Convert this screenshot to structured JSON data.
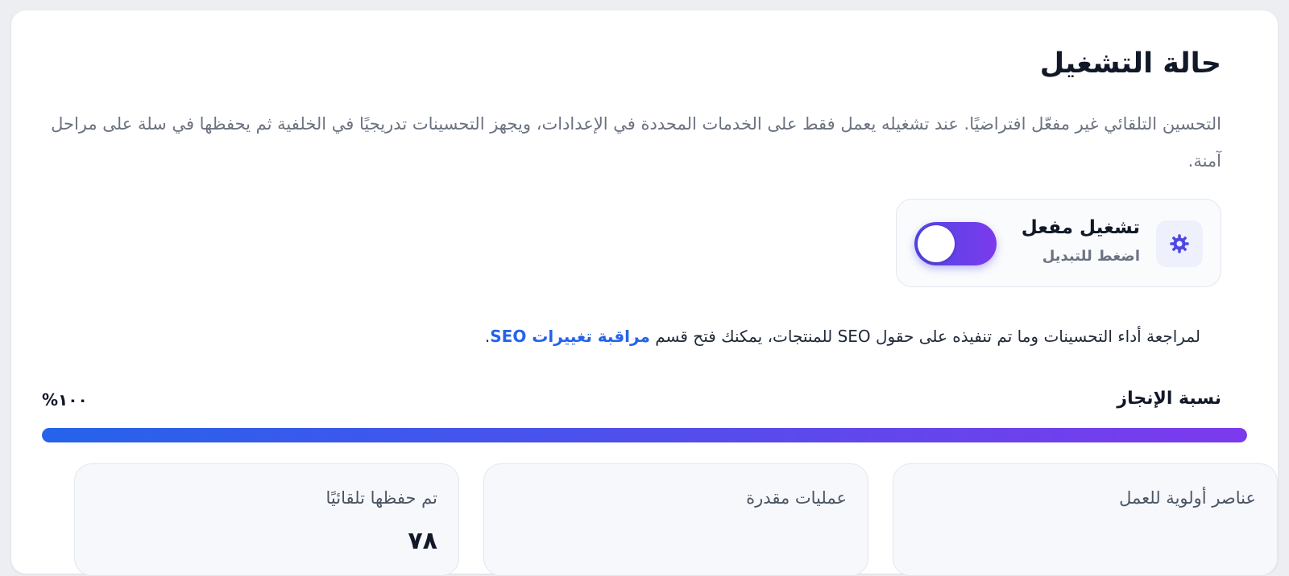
{
  "status": {
    "title": "حالة التشغيل",
    "description": "التحسين التلقائي غير مفعّل افتراضيًا. عند تشغيله يعمل فقط على الخدمات المحددة في الإعدادات، ويجهز التحسينات تدريجيًا في الخلفية ثم يحفظها في سلة على مراحل آمنة."
  },
  "toggle": {
    "title": "تشغيل مفعل",
    "subtitle": "اضغط للتبديل",
    "icon": "gear-icon",
    "enabled": true
  },
  "note": {
    "before": "لمراجعة أداء التحسينات وما تم تنفيذه على حقول SEO للمنتجات، يمكنك فتح قسم ",
    "link": "مراقبة تغييرات SEO",
    "after": "."
  },
  "progress": {
    "label": "نسبة الإنجاز",
    "value_text": "١٠٠%",
    "percent": 100
  },
  "stats": [
    {
      "label": "عناصر أولوية للعمل",
      "value": ""
    },
    {
      "label": "عمليات مقدرة",
      "value": ""
    },
    {
      "label": "تم حفظها تلقائيًا",
      "value": "٧٨"
    }
  ],
  "colors": {
    "accent": "#4f46e5",
    "accent_end": "#7c3aed",
    "link": "#2563eb"
  }
}
